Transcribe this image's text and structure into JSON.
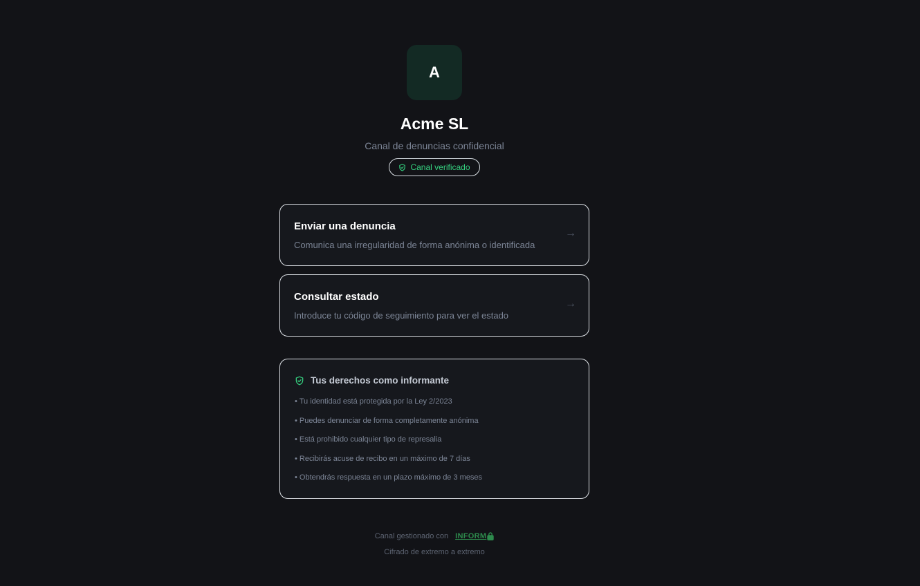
{
  "org": {
    "logo_letter": "A",
    "name": "Acme SL",
    "subtitle": "Canal de denuncias confidencial",
    "badge": "Canal verificado"
  },
  "actions": {
    "send": {
      "title": "Enviar una denuncia",
      "description": "Comunica una irregularidad de forma anónima o identificada",
      "arrow": "→"
    },
    "status": {
      "title": "Consultar estado",
      "description": "Introduce tu código de seguimiento para ver el estado",
      "arrow": "→"
    }
  },
  "rights": {
    "title": "Tus derechos como informante",
    "items": [
      "• Tu identidad está protegida por la Ley 2/2023",
      "• Puedes denunciar de forma completamente anónima",
      "• Está prohibido cualquier tipo de represalia",
      "• Recibirás acuse de recibo en un máximo de 7 días",
      "• Obtendrás respuesta en un plazo máximo de 3 meses"
    ]
  },
  "footer": {
    "managed_by": "Canal gestionado con",
    "brand": "INFORM",
    "encryption": "Cifrado de extremo a extremo"
  },
  "colors": {
    "background": "#121317",
    "accent_green": "#35d07f",
    "logo_bg": "#132a24",
    "muted_text": "#7c8596"
  },
  "icons": {
    "badge": "shield-check-icon",
    "rights": "shield-check-icon",
    "brand": "lock-icon",
    "card_arrow": "arrow-right-icon"
  }
}
